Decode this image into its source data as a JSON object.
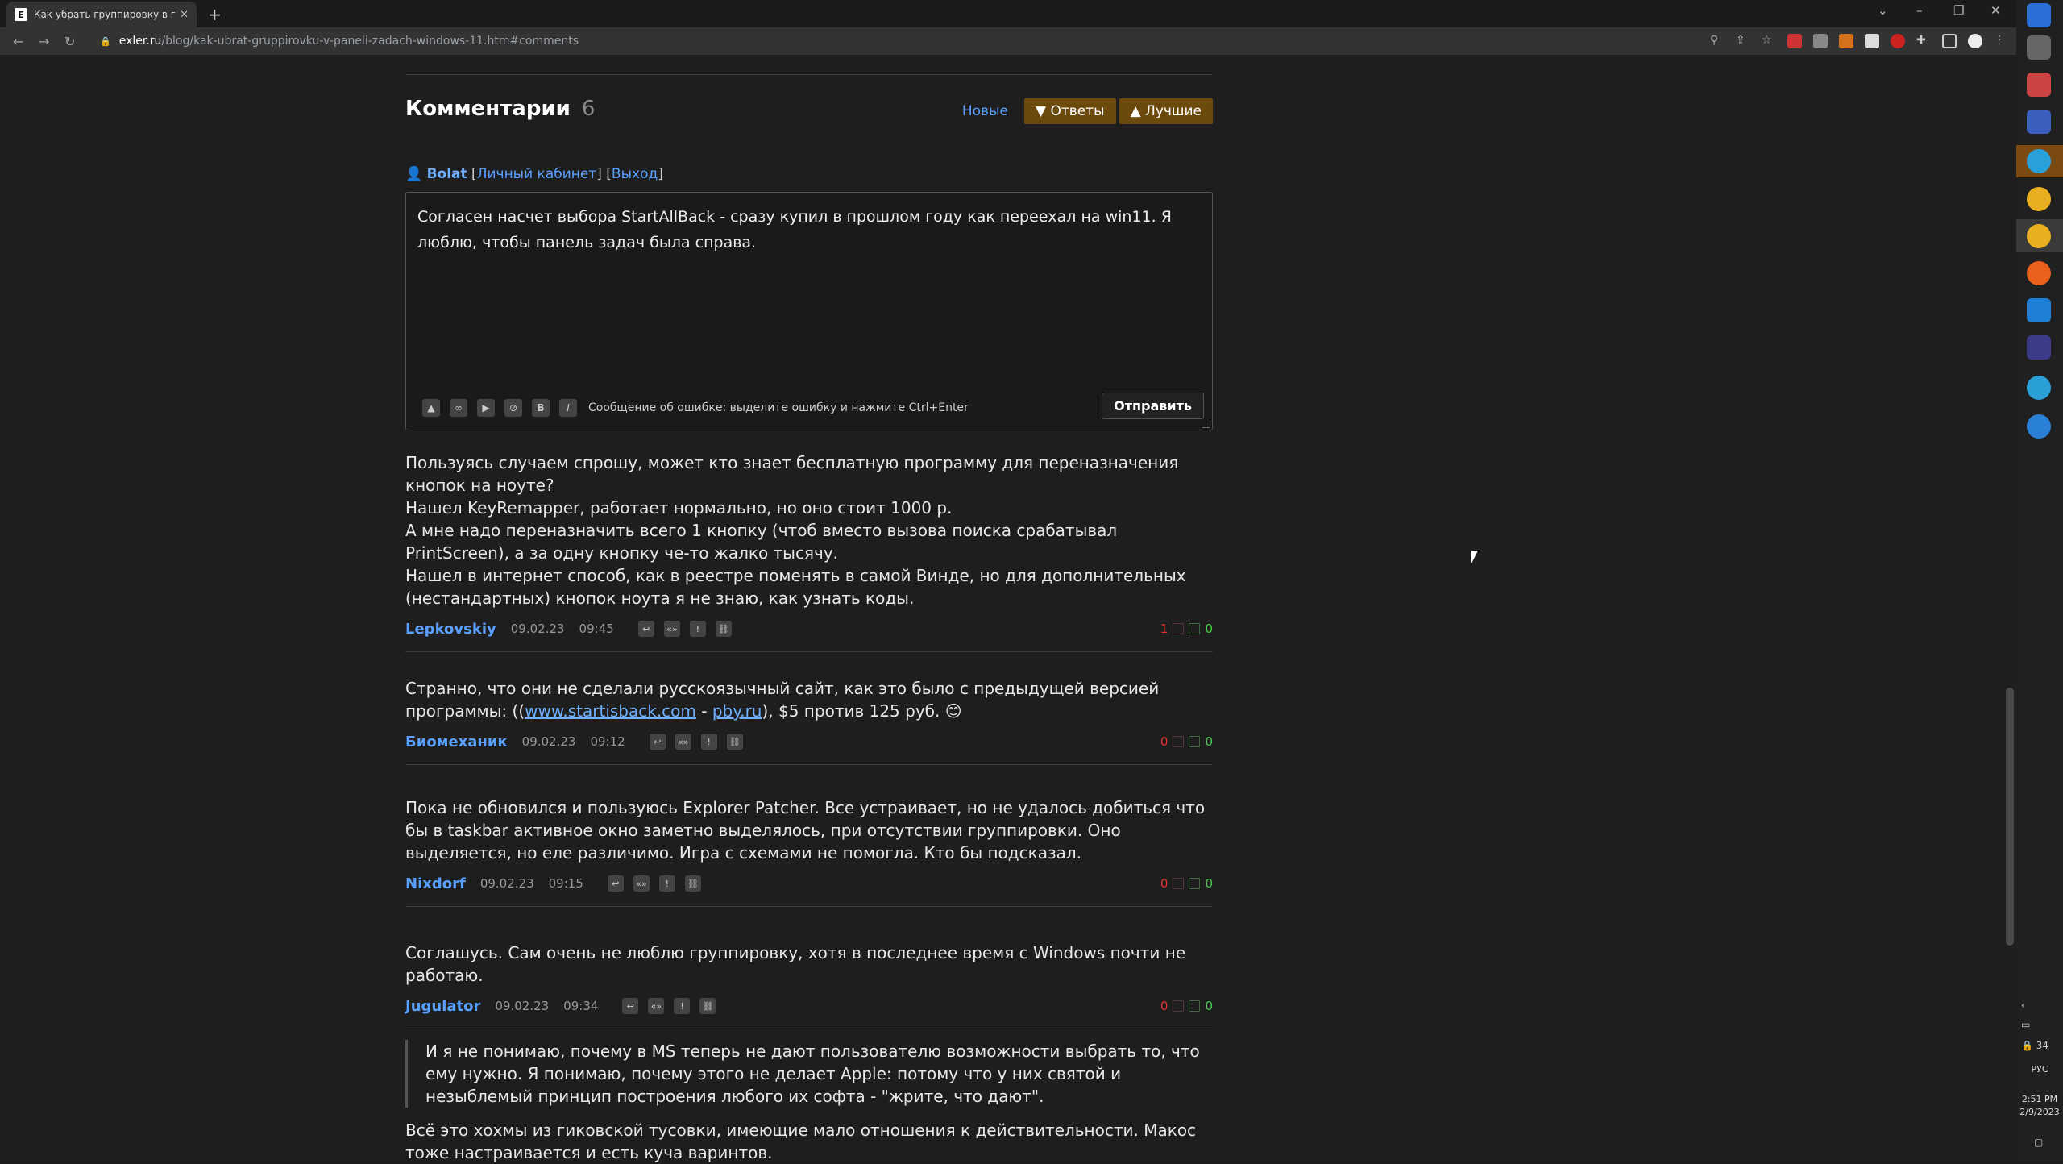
{
  "browser": {
    "tab_title": "Как убрать группировку в пане",
    "favicon_letter": "E",
    "url_domain": "exler.ru",
    "url_path": "/blog/kak-ubrat-gruppirovku-v-paneli-zadach-windows-11.htm#comments"
  },
  "comments_header": {
    "title": "Комментарии",
    "count": "6",
    "sort_new": "Новые",
    "sort_replies": "▼ Ответы",
    "sort_best": "▲ Лучшие"
  },
  "user": {
    "name": "Bolat",
    "cabinet": "Личный кабинет",
    "logout": "Выход"
  },
  "editor": {
    "text": "Согласен насчет выбора StartAllBack - сразу купил в прошлом году как переехал на win11. Я люблю, чтобы панель задач была справа.",
    "hint": "Сообщение об ошибке: выделите ошибку и нажмите Ctrl+Enter",
    "send_label": "Отправить"
  },
  "comments": [
    {
      "lines": [
        "Пользуясь случаем спрошу, может кто знает бесплатную программу для переназначения кнопок на ноуте?",
        "Нашел KeyRemapper, работает нормально, но оно стоит 1000 р.",
        "А мне надо переназначить всего 1 кнопку (чтоб вместо вызова поиска срабатывал PrintScreen), а за одну кнопку че-то жалко тысячу.",
        "Нашел в интернет способ, как в реестре поменять в самой Винде, но для дополнительных (нестандартных) кнопок ноута я не знаю, как узнать коды."
      ],
      "author": "Lepkovskiy",
      "date": "09.02.23",
      "time": "09:45",
      "neg": "1",
      "pos": "0"
    },
    {
      "text_a": "Странно, что они не сделали русскоязычный сайт, как это было с предыдущей версией программы: ((",
      "link1": "www.startisback.com",
      "text_b": " - ",
      "link2": "pby.ru",
      "text_c": "), $5 против 125 руб. 😊",
      "author": "Биомеханик",
      "date": "09.02.23",
      "time": "09:12",
      "neg": "0",
      "pos": "0"
    },
    {
      "text": "Пока не обновился и пользуюсь Explorer Patcher. Все устраивает, но не удалось добиться что бы в taskbar активное окно заметно выделялось, при отсутствии группировки. Оно выделяется, но еле различимо. Игра с схемами не помогла. Кто бы подсказал.",
      "author": "Nixdorf",
      "date": "09.02.23",
      "time": "09:15",
      "neg": "0",
      "pos": "0"
    },
    {
      "text": "Соглашусь. Сам очень не люблю группировку, хотя в последнее время с Windows почти не работаю.",
      "author": "Jugulator",
      "date": "09.02.23",
      "time": "09:34",
      "neg": "0",
      "pos": "0"
    },
    {
      "quote": "И я не понимаю, почему в MS теперь не дают пользователю возможности выбрать то, что ему нужно. Я понимаю, почему этого не делает Apple: потому что у них святой и незыблемый принцип построения любого их софта - \"жрите, что дают\".",
      "text": "Всё это хохмы из гиковской тусовки, имеющие мало отношения к действительности. Макос тоже настраивается и есть куча варинтов."
    }
  ],
  "taskbar": {
    "lang": "РУС",
    "time": "2:51 PM",
    "date": "2/9/2023",
    "volume_label": "34"
  },
  "colors": {
    "link": "#5aa0ff",
    "sort_button_bg": "#6b4a0c",
    "vote_negative": "#dd3333",
    "vote_positive": "#44cc44"
  }
}
